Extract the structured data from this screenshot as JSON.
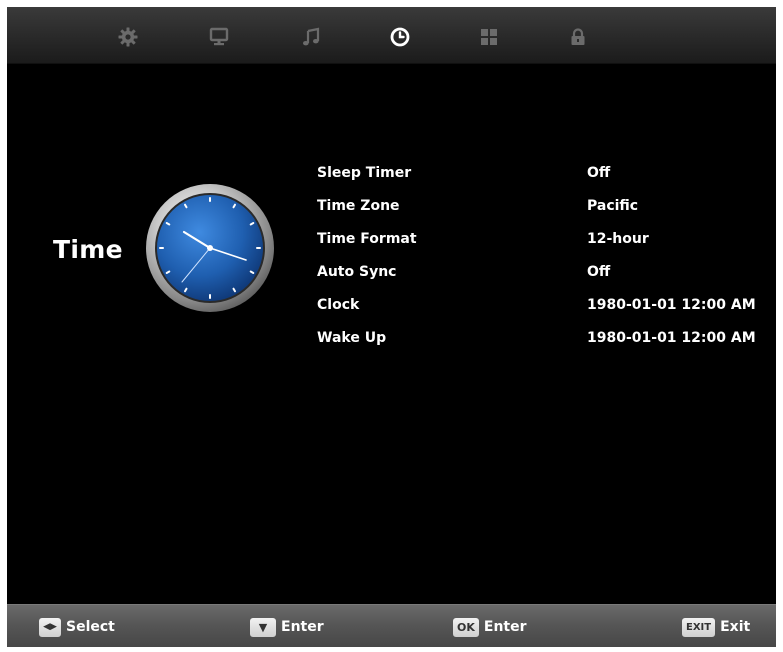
{
  "tabs": [
    {
      "icon": "gear-icon",
      "active": false
    },
    {
      "icon": "monitor-icon",
      "active": false
    },
    {
      "icon": "music-note-icon",
      "active": false
    },
    {
      "icon": "clock-icon",
      "active": true
    },
    {
      "icon": "apps-grid-icon",
      "active": false
    },
    {
      "icon": "lock-icon",
      "active": false
    }
  ],
  "section": {
    "title": "Time",
    "icon": "analog-clock-icon"
  },
  "settings": [
    {
      "label": "Sleep Timer",
      "value": "Off"
    },
    {
      "label": "Time Zone",
      "value": "Pacific"
    },
    {
      "label": "Time Format",
      "value": "12-hour"
    },
    {
      "label": "Auto Sync",
      "value": "Off"
    },
    {
      "label": "Clock",
      "value": "1980-01-01 12:00 AM"
    },
    {
      "label": "Wake Up",
      "value": "1980-01-01 12:00 AM"
    }
  ],
  "hints": [
    {
      "key": "◀▶",
      "label": "Select"
    },
    {
      "key": "▼",
      "label": "Enter"
    },
    {
      "key": "OK",
      "label": "Enter"
    },
    {
      "key": "EXIT",
      "label": "Exit"
    }
  ],
  "colors": {
    "background": "#000000",
    "tab_inactive": "#6b6b6b",
    "tab_active": "#ffffff",
    "hint_bar": "#555555",
    "clock_face": "#1f5fb0"
  }
}
